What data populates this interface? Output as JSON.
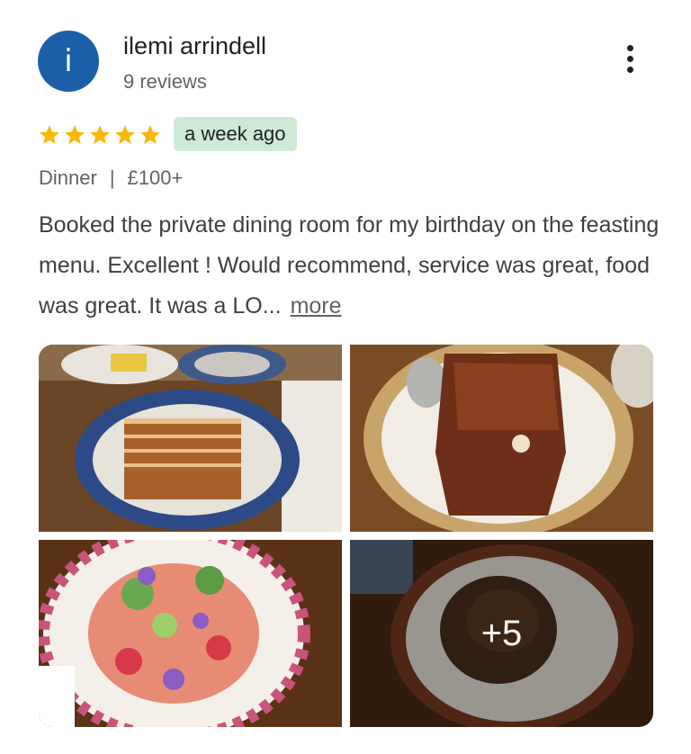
{
  "reviewer": {
    "avatar_letter": "i",
    "avatar_color": "#1a5fa8",
    "name": "ilemi arrindell",
    "review_count": "9 reviews"
  },
  "menu_icon": "more-vertical-icon",
  "rating": {
    "stars": 5,
    "max": 5,
    "star_color": "#f9b807"
  },
  "time_ago": "a week ago",
  "meal_type": "Dinner",
  "separator": "|",
  "price": "£100+",
  "review_text": "Booked the private dining room for my birthday on the feasting menu. Excellent ! Would recommend, service was great, food was great. It was a LO...",
  "more_label": "more",
  "photos": {
    "extra_count": "+5",
    "items": [
      "food-photo",
      "food-photo",
      "food-photo",
      "food-photo"
    ]
  }
}
